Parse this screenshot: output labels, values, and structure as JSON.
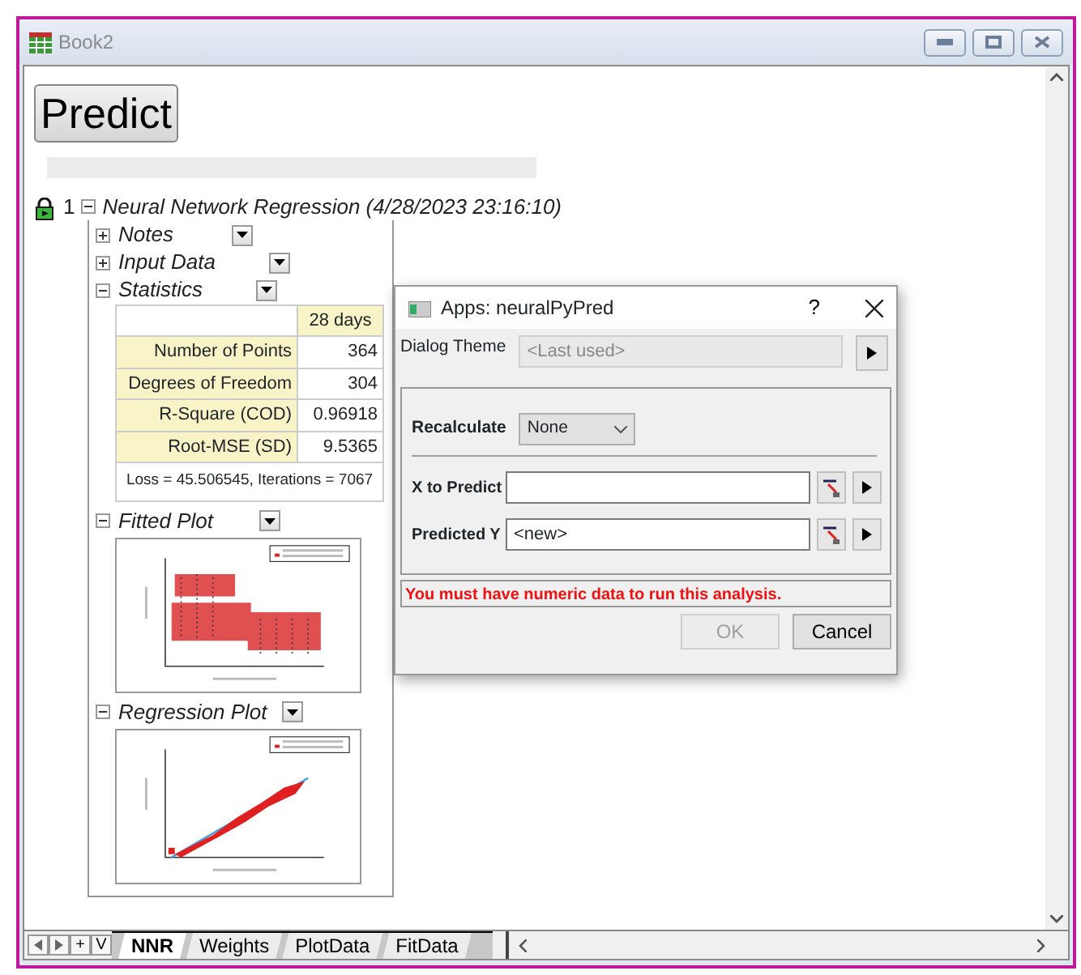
{
  "window": {
    "title": "Book2"
  },
  "predict_button": "Predict",
  "report": {
    "index": "1",
    "title": "Neural Network Regression (4/28/2023 23:16:10)",
    "expanded": true,
    "sections": [
      {
        "label": "Notes",
        "expanded": false
      },
      {
        "label": "Input Data",
        "expanded": false
      },
      {
        "label": "Statistics",
        "expanded": true,
        "kind": "table",
        "table": {
          "column_header": "28 days",
          "rows": [
            [
              "Number of Points",
              "364"
            ],
            [
              "Degrees of Freedom",
              "304"
            ],
            [
              "R-Square (COD)",
              "0.96918"
            ],
            [
              "Root-MSE (SD)",
              "9.5365"
            ]
          ],
          "footnote": "Loss = 45.506545, Iterations = 7067"
        }
      },
      {
        "label": "Fitted Plot",
        "expanded": true,
        "kind": "scatter"
      },
      {
        "label": "Regression Plot",
        "expanded": true,
        "kind": "regression"
      }
    ]
  },
  "dialog": {
    "title": "Apps: neuralPyPred",
    "help": "?",
    "theme_label": "Dialog Theme",
    "theme_value": "<Last used>",
    "recalculate": {
      "label": "Recalculate",
      "value": "None"
    },
    "fields": [
      {
        "label": "X to Predict"
      },
      {
        "label": "Predicted Y",
        "value": "<new>"
      }
    ],
    "error": "You must have numeric data to run this analysis.",
    "buttons": [
      {
        "label": "OK",
        "disabled": true
      },
      {
        "label": "Cancel",
        "disabled": false
      }
    ]
  },
  "sheet_nav": [
    "+",
    "V"
  ],
  "sheet_tabs": [
    {
      "label": "NNR",
      "selected": true
    },
    {
      "label": "Weights",
      "selected": false
    },
    {
      "label": "PlotData",
      "selected": false
    },
    {
      "label": "FitData",
      "selected": false
    }
  ]
}
